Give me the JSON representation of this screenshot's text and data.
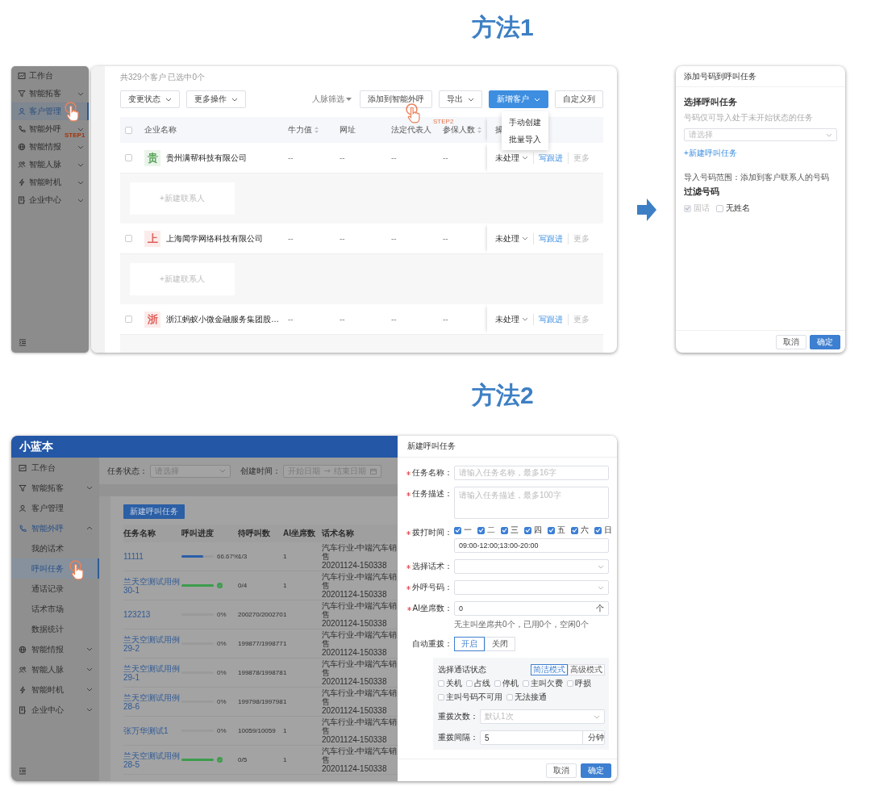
{
  "method1": {
    "heading": "方法1",
    "sidebar": [
      {
        "label": "工作台",
        "selected": false
      },
      {
        "label": "智能拓客",
        "expanded": false,
        "selected": false
      },
      {
        "label": "客户管理",
        "selected": true
      },
      {
        "label": "智能外呼",
        "expanded": false,
        "selected": false
      },
      {
        "label": "智能情报",
        "expanded": false,
        "selected": false
      },
      {
        "label": "智能人脉",
        "expanded": false,
        "selected": false
      },
      {
        "label": "智能时机",
        "expanded": false,
        "selected": false
      },
      {
        "label": "企业中心",
        "expanded": false,
        "selected": false
      }
    ],
    "step1_label": "STEP1",
    "summary": "共329个客户 已选中0个",
    "bulk_actions": [
      "变更状态",
      "更多操作"
    ],
    "network_filter": "人脉筛选",
    "add_to_calls_button": "添加到智能外呼",
    "step2_label": "STEP2",
    "export_button": "导出",
    "new_customer_button": "新增客户",
    "new_customer_menu": [
      "手动创建",
      "批量导入"
    ],
    "custom_columns_button": "自定义列",
    "select_all_checked": false,
    "columns": [
      {
        "label": "企业名称",
        "sortable": false
      },
      {
        "label": "牛力值",
        "sortable": true
      },
      {
        "label": "网址",
        "sortable": false
      },
      {
        "label": "法定代表人",
        "sortable": false
      },
      {
        "label": "参保人数",
        "sortable": true
      },
      {
        "label": "操"
      }
    ],
    "rows": [
      {
        "checked": false,
        "avatar": "贵",
        "color": "#5aa55a",
        "cells": [
          "贵州满帮科技有限公司",
          "--",
          "--",
          "--",
          "--"
        ],
        "status": "未处理",
        "follow_up": "写跟进",
        "more": "更多",
        "add_contact": "+新建联系人"
      },
      {
        "checked": false,
        "avatar": "上",
        "color": "#e0605a",
        "cells": [
          "上海闻学网络科技有限公司",
          "--",
          "--",
          "--",
          "--"
        ],
        "status": "未处理",
        "follow_up": "写跟进",
        "more": "更多",
        "add_contact": "+新建联系人"
      },
      {
        "checked": false,
        "avatar": "浙",
        "color": "#e0605a",
        "cells": [
          "浙江蚂蚁小微金融服务集团股…",
          "--",
          "--",
          "--",
          "--"
        ],
        "status": "未处理",
        "follow_up": "写跟进",
        "more": "更多"
      }
    ],
    "dialog": {
      "title": "添加号码到呼叫任务",
      "section": "选择呼叫任务",
      "hint": "号码仅可导入处于未开始状态的任务",
      "select_placeholder": "请选择",
      "new_task_link": "+新建呼叫任务",
      "import_range": "导入号码范围：添加到客户联系人的号码",
      "filter_title": "过滤号码",
      "filters": [
        {
          "label": "固话",
          "checked": true,
          "disabled": true
        },
        {
          "label": "无姓名",
          "checked": false,
          "disabled": false
        }
      ],
      "buttons": [
        {
          "label": "取消",
          "primary": false
        },
        {
          "label": "确定",
          "primary": true
        }
      ]
    }
  },
  "method2": {
    "heading": "方法2",
    "app_title": "小蓝本",
    "sidebar": [
      {
        "label": "工作台",
        "selected": false
      },
      {
        "label": "智能拓客",
        "expanded": false,
        "selected": false
      },
      {
        "label": "客户管理",
        "selected": false
      },
      {
        "label": "智能外呼",
        "expanded": true,
        "selected": false,
        "children": [
          {
            "label": "我的话术",
            "selected": false
          },
          {
            "label": "呼叫任务",
            "selected": true
          },
          {
            "label": "通话记录",
            "selected": false
          },
          {
            "label": "话术市场",
            "selected": false
          },
          {
            "label": "数据统计",
            "selected": false
          }
        ]
      },
      {
        "label": "智能情报",
        "expanded": false,
        "selected": false
      },
      {
        "label": "智能人脉",
        "expanded": false,
        "selected": false
      },
      {
        "label": "智能时机",
        "expanded": false,
        "selected": false
      },
      {
        "label": "企业中心",
        "expanded": false,
        "selected": false
      }
    ],
    "status_filter": {
      "label": "任务状态：",
      "placeholder": "请选择"
    },
    "date_filter": {
      "label": "创建时间：",
      "start_placeholder": "开始日期",
      "end_placeholder": "结束日期"
    },
    "new_task_button": "新建呼叫任务",
    "columns": [
      "任务名称",
      "呼叫进度",
      "待呼叫数",
      "AI坐席数",
      "话术名称"
    ],
    "tasks": [
      {
        "name": "11111",
        "level": 0.6667,
        "done": false,
        "percent": "66.67%",
        "pending": "1/3",
        "seats": "1",
        "script": "汽车行业-中端汽车销售\n20201124-150338"
      },
      {
        "name": "兰天空测试用例30-1",
        "level": 1,
        "done": true,
        "pending": "0/4",
        "seats": "1",
        "script": "汽车行业-中端汽车销售\n20201124-150338"
      },
      {
        "name": "123213",
        "level": 0,
        "done": false,
        "percent": "0%",
        "pending": "200270/200270",
        "seats": "1",
        "script": "汽车行业-中端汽车销售\n20201124-150338"
      },
      {
        "name": "兰天空测试用例29-2",
        "level": 0,
        "done": false,
        "percent": "0%",
        "pending": "199877/199877",
        "seats": "1",
        "script": "汽车行业-中端汽车销售\n20201124-150338"
      },
      {
        "name": "兰天空测试用例29-1",
        "level": 0,
        "done": false,
        "percent": "0%",
        "pending": "199878/199878",
        "seats": "1",
        "script": "汽车行业-中端汽车销售\n20201124-150338"
      },
      {
        "name": "兰天空测试用例28-6",
        "level": 0,
        "done": false,
        "percent": "0%",
        "pending": "199798/199798",
        "seats": "1",
        "script": "汽车行业-中端汽车销售\n20201124-150338"
      },
      {
        "name": "张万华测试1",
        "level": 0,
        "done": false,
        "percent": "0%",
        "pending": "10059/10059",
        "seats": "1",
        "script": "汽车行业-中端汽车销售\n20201124-150338"
      },
      {
        "name": "兰天空测试用例28-5",
        "level": 1,
        "done": true,
        "pending": "0/5",
        "seats": "1",
        "script": "汽车行业-中端汽车销售\n20201124-150338"
      }
    ],
    "drawer": {
      "title": "新建呼叫任务",
      "fields": [
        {
          "kind": "text",
          "required": true,
          "label": "任务名称：",
          "placeholder": "请输入任务名称，最多16字"
        },
        {
          "kind": "textarea",
          "required": true,
          "label": "任务描述：",
          "placeholder": "请输入任务描述，最多100字"
        },
        {
          "kind": "days",
          "required": true,
          "label": "拨打时间：",
          "days": [
            {
              "label": "一",
              "checked": true
            },
            {
              "label": "二",
              "checked": true
            },
            {
              "label": "三",
              "checked": true
            },
            {
              "label": "四",
              "checked": true
            },
            {
              "label": "五",
              "checked": true
            },
            {
              "label": "六",
              "checked": true
            },
            {
              "label": "日",
              "checked": true
            }
          ],
          "value": "09:00-12:00;13:00-20:00"
        },
        {
          "kind": "select",
          "required": true,
          "label": "选择话术："
        },
        {
          "kind": "select",
          "required": true,
          "label": "外呼号码："
        },
        {
          "kind": "number",
          "required": true,
          "label": "AI坐席数：",
          "value": "0",
          "unit": "个",
          "hint": "无主叫坐席共0个，已用0个，空闲0个"
        },
        {
          "kind": "toggle",
          "required": false,
          "label": "自动重拨：",
          "options": [
            {
              "label": "开启",
              "selected": true
            },
            {
              "label": "关闭",
              "selected": false
            }
          ]
        }
      ],
      "redial": {
        "title": "选择通话状态",
        "modes": [
          {
            "label": "简洁模式",
            "selected": true
          },
          {
            "label": "高级模式",
            "selected": false
          }
        ],
        "statuses": [
          {
            "label": "关机",
            "checked": false
          },
          {
            "label": "占线",
            "checked": false
          },
          {
            "label": "停机",
            "checked": false
          },
          {
            "label": "主叫欠费",
            "checked": false
          },
          {
            "label": "呼损",
            "checked": false
          },
          {
            "label": "主叫号码不可用",
            "checked": false
          },
          {
            "label": "无法接通",
            "checked": false
          }
        ],
        "count_label": "重拨次数：",
        "count_placeholder": "默认1次",
        "interval_label": "重拨间隔：",
        "interval_value": "5",
        "interval_unit": "分钟"
      },
      "buttons": [
        {
          "label": "取消",
          "primary": false
        },
        {
          "label": "确定",
          "primary": true
        }
      ]
    }
  }
}
